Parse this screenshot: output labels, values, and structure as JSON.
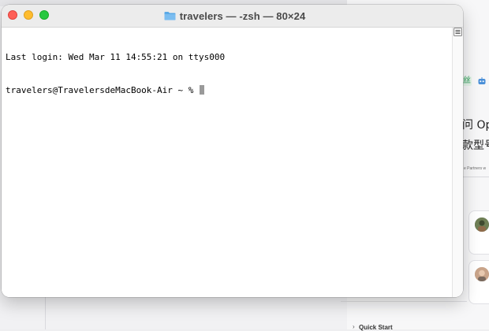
{
  "terminal": {
    "title": "travelers — -zsh — 80×24",
    "lines": [
      "Last login: Wed Mar 11 14:55:21 on ttys000",
      "travelers@TravelersdeMacBook-Air ~ % "
    ],
    "icons": {
      "title": "folder-icon",
      "close": "close-button",
      "minimize": "minimize-button",
      "zoom": "zoom-button",
      "marks": "marks-icon"
    }
  },
  "background": {
    "tag_text": "丝",
    "text_line_1": "问 Op",
    "text_line_2": "款型号",
    "small_text": "e Partners w",
    "quick_start": "Quick Start"
  },
  "colors": {
    "close": "#fe5f57",
    "minimize": "#febc2e",
    "zoom": "#28c840",
    "folder": "#5aa9e6"
  }
}
